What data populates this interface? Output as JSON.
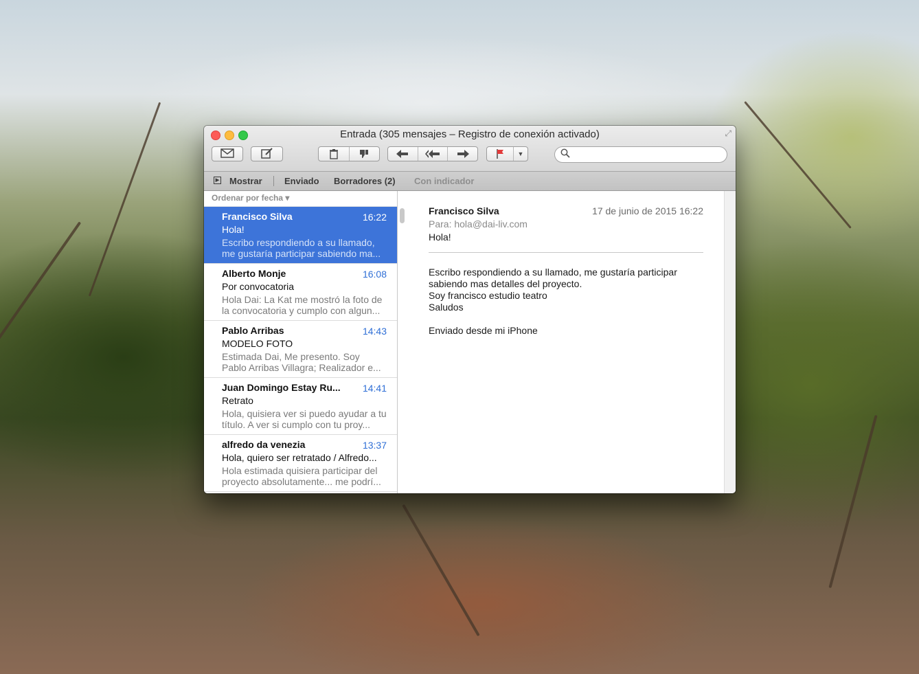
{
  "window": {
    "title": "Entrada (305 mensajes – Registro de conexión activado)"
  },
  "toolbar": {
    "icons": [
      "envelope-icon",
      "compose-icon",
      "trash-icon",
      "junk-icon",
      "reply-icon",
      "reply-all-icon",
      "forward-icon",
      "flag-icon",
      "chevron-down-icon",
      "search-icon"
    ]
  },
  "favorites": {
    "show": "Mostrar",
    "sent": "Enviado",
    "drafts": "Borradores (2)",
    "flagged": "Con indicador"
  },
  "list": {
    "sort_label": "Ordenar por fecha ▾",
    "messages": [
      {
        "from": "Francisco Silva",
        "time": "16:22",
        "subject": "Hola!",
        "preview": "Escribo respondiendo a su llamado, me gustaría participar sabiendo ma..."
      },
      {
        "from": "Alberto Monje",
        "time": "16:08",
        "subject": "Por convocatoria",
        "preview": "Hola Dai: La Kat me mostró la foto de la convocatoria y cumplo con algun..."
      },
      {
        "from": "Pablo Arribas",
        "time": "14:43",
        "subject": "MODELO FOTO",
        "preview": "Estimada Dai, Me presento. Soy Pablo Arribas Villagra; Realizador e..."
      },
      {
        "from": "Juan Domingo Estay Ru...",
        "time": "14:41",
        "subject": "Retrato",
        "preview": "Hola, quisiera ver si puedo ayudar a tu título. A ver si cumplo con tu proy..."
      },
      {
        "from": "alfredo da venezia",
        "time": "13:37",
        "subject": "Hola, quiero ser retratado / Alfredo...",
        "preview": "Hola estimada quisiera participar del proyecto absolutamente... me podrí..."
      }
    ]
  },
  "message": {
    "from": "Francisco Silva",
    "date": "17 de junio de 2015 16:22",
    "to_label": "Para:",
    "to": "hola@dai-liv.com",
    "subject": "Hola!",
    "body_line1": "Escribo respondiendo a su llamado, me gustaría participar",
    "body_line2": "sabiendo mas detalles del proyecto.",
    "body_line3": "Soy francisco estudio teatro",
    "body_line4": "Saludos",
    "body_line5": "Enviado desde mi iPhone"
  },
  "colors": {
    "selection": "#3d74d9",
    "time": "#2f6fd6"
  }
}
